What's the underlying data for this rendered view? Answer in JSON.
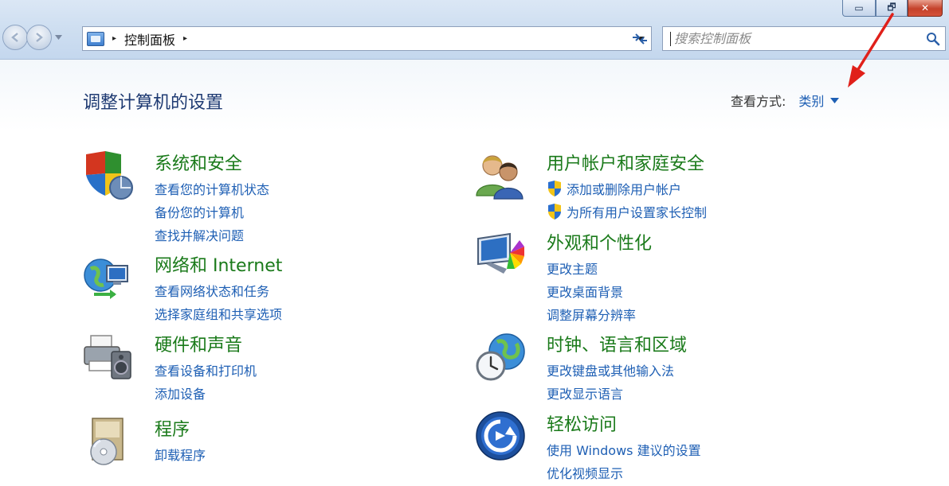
{
  "window": {
    "min_label": "▭",
    "restore_label": "🗗",
    "close_label": "✕"
  },
  "address_bar": {
    "sep_start": "▸",
    "path": "控制面板",
    "sep_end": "▸"
  },
  "search": {
    "placeholder": "搜索控制面板"
  },
  "header": {
    "title": "调整计算机的设置",
    "view_label": "查看方式:",
    "view_value": "类别"
  },
  "categories": [
    {
      "title": "系统和安全",
      "links": [
        "查看您的计算机状态",
        "备份您的计算机",
        "查找并解决问题"
      ]
    },
    {
      "title": "网络和 Internet",
      "links": [
        "查看网络状态和任务",
        "选择家庭组和共享选项"
      ]
    },
    {
      "title": "硬件和声音",
      "links": [
        "查看设备和打印机",
        "添加设备"
      ]
    },
    {
      "title": "程序",
      "links": [
        "卸载程序"
      ]
    },
    {
      "title": "用户帐户和家庭安全",
      "links": [
        "添加或删除用户帐户",
        "为所有用户设置家长控制"
      ]
    },
    {
      "title": "外观和个性化",
      "links": [
        "更改主题",
        "更改桌面背景",
        "调整屏幕分辨率"
      ]
    },
    {
      "title": "时钟、语言和区域",
      "links": [
        "更改键盘或其他输入法",
        "更改显示语言"
      ]
    },
    {
      "title": "轻松访问",
      "links": [
        "使用 Windows 建议的设置",
        "优化视频显示"
      ]
    }
  ],
  "colors": {
    "category_title": "#1a7a1a",
    "link": "#1e5fb4",
    "page_title": "#1e3a72",
    "annotation_arrow": "#e0201a"
  }
}
